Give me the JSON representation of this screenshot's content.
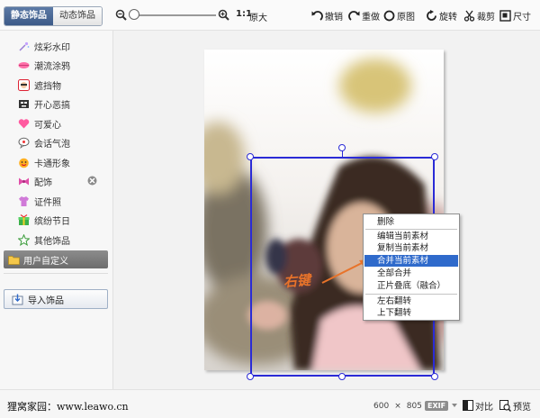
{
  "tabs": {
    "static": "静态饰品",
    "dynamic": "动态饰品"
  },
  "toolbar": {
    "ratio": "1:1",
    "original_size": "原大",
    "undo": "撤销",
    "redo": "重做",
    "original_image": "原图",
    "rotate": "旋转",
    "crop": "裁剪",
    "size": "尺寸"
  },
  "sidebar": {
    "items": [
      {
        "label": "炫彩水印"
      },
      {
        "label": "潮流涂鸦"
      },
      {
        "label": "遮挡物"
      },
      {
        "label": "开心恶搞"
      },
      {
        "label": "可爱心"
      },
      {
        "label": "会话气泡"
      },
      {
        "label": "卡通形象"
      },
      {
        "label": "配饰"
      },
      {
        "label": "证件照"
      },
      {
        "label": "缤纷节日"
      },
      {
        "label": "其他饰品"
      }
    ],
    "selected_item": "用户自定义",
    "import_button": "导入饰品"
  },
  "annotation": {
    "text": "右键"
  },
  "context_menu": {
    "items": [
      "删除",
      "编辑当前素材",
      "复制当前素材",
      "合并当前素材",
      "全部合并",
      "正片叠底（融合）",
      "左右翻转",
      "上下翻转"
    ],
    "highlighted_index": 3
  },
  "bottom": {
    "watermark": "狸窝家园：www.leawo.cn",
    "image_width": "600",
    "times": "×",
    "image_height": "805",
    "exif": "EXIF",
    "compare": "对比",
    "preview": "预览"
  },
  "colors": {
    "accent_blue": "#2f6acb",
    "selection_blue": "#2b2bd6",
    "annotation_orange": "#e8732a",
    "active_tab": "#4a6896"
  }
}
